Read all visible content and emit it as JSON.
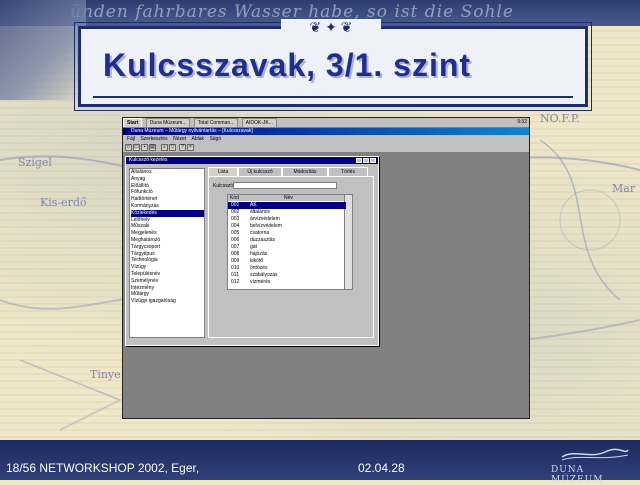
{
  "slide": {
    "title": "Kulcsszavak, 3/1. szint",
    "script_text": "ünden fahrbares Wasser habe, so ist die Sohle",
    "footer_left": "18/56 NETWORKSHOP 2002, Eger,",
    "footer_date": "02.04.28",
    "logo_text": "DUNA MÚZEUM",
    "ornament": "❦ ✦ ❦",
    "map_labels": [
      "Szigel",
      "Kis-erdő",
      "Tinye",
      "NO.F.P.",
      "Mar"
    ]
  },
  "screenshot": {
    "taskbar": {
      "start": "Start",
      "tasks": [
        "Duna Múzeum...",
        "Total Comman...",
        "AIDOK-JK..."
      ],
      "clock": "9:32"
    },
    "app_title": "Duna Múzeum – Műtárgy nyilvántartás – [Kulcsszavak]",
    "menu": [
      "Fájl",
      "Szerkesztés",
      "Nézet",
      "Ablak",
      "Súgó"
    ],
    "dialog": {
      "title": "Kulcsszó kezelés",
      "list_items": [
        "Általános",
        "Anyag",
        "Előállító",
        "Főfunkció",
        "Hadtörténet",
        "Kormányzás",
        "Közlekedés",
        "Lelőhely",
        "Műszaki",
        "Megjelenés",
        "Meghatározó",
        "Tárgycsoport",
        "Tárgytípus",
        "Technológia",
        "Vízügy",
        "Településnév",
        "Személynév",
        "Intézmény",
        "Műtárgy",
        "Vízügyi igazgatóság"
      ],
      "selected_index": 6,
      "tabs": [
        "Lista",
        "Új kulcsszó",
        "Módosítás",
        "Törlés"
      ],
      "keyword_label": "Kulcsszó:",
      "grid_headers": [
        "Kód",
        "Név"
      ],
      "grid_rows": [
        {
          "code": "001",
          "name": "ÁK"
        },
        {
          "code": "002",
          "name": "általános"
        },
        {
          "code": "003",
          "name": "árvízvédelem"
        },
        {
          "code": "004",
          "name": "belvízvédelem"
        },
        {
          "code": "005",
          "name": "csatorna"
        },
        {
          "code": "006",
          "name": "duzzasztás"
        },
        {
          "code": "007",
          "name": "gát"
        },
        {
          "code": "008",
          "name": "hajózás"
        },
        {
          "code": "009",
          "name": "kikötő"
        },
        {
          "code": "010",
          "name": "öntözés"
        },
        {
          "code": "011",
          "name": "szabályozás"
        },
        {
          "code": "012",
          "name": "vízmérés"
        }
      ],
      "grid_selected_index": 0
    }
  }
}
